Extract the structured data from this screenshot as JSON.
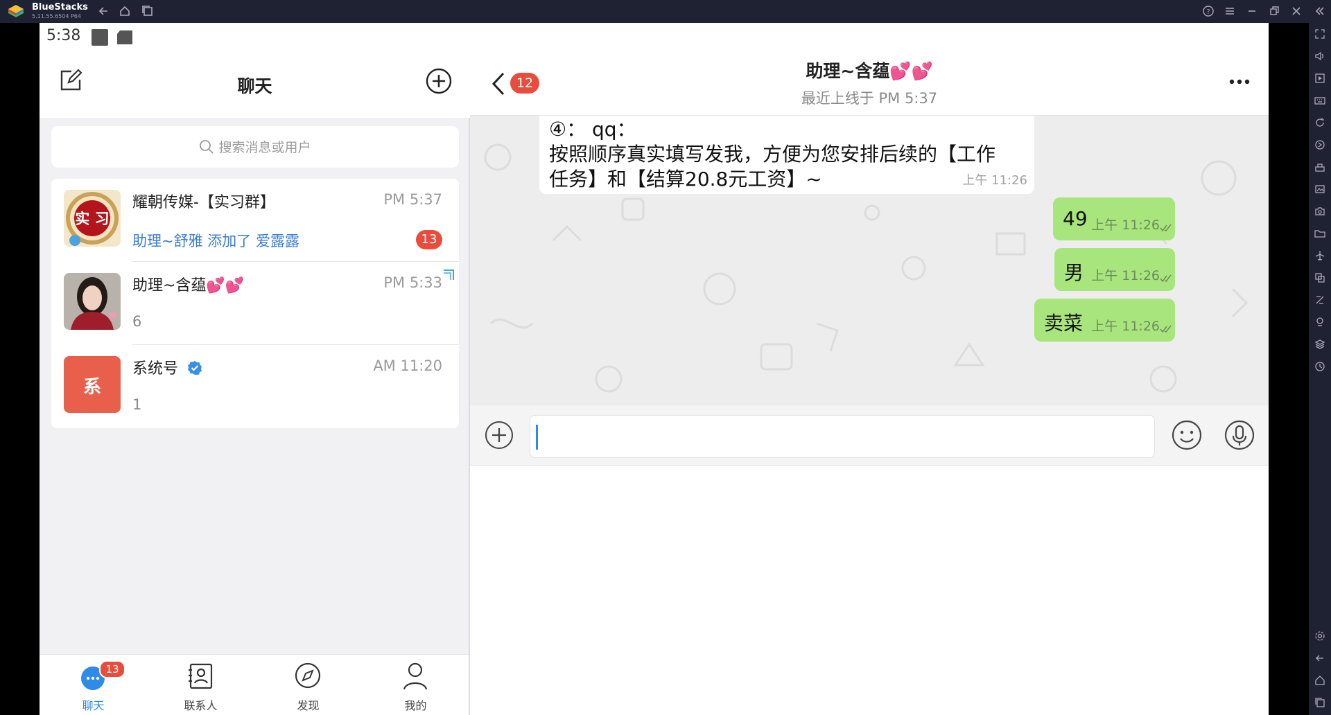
{
  "emulator": {
    "name": "BlueStacks",
    "version": "5.11.55.6504 P64"
  },
  "status_bar": {
    "time": "5:38"
  },
  "left_panel": {
    "title": "聊天",
    "search_placeholder": "搜索消息或用户",
    "chats": [
      {
        "avatar_text": "实 习",
        "name": "耀朝传媒-【实习群】",
        "time": "PM 5:37",
        "message": "助理~舒雅 添加了 爱露露",
        "badge": "13"
      },
      {
        "name": "助理~含蕴💕💕",
        "time": "PM 5:33",
        "message": "6"
      },
      {
        "avatar_text": "系",
        "name": "系统号",
        "time": "AM 11:20",
        "message": "1"
      }
    ],
    "tabs": [
      {
        "label": "聊天",
        "badge": "13"
      },
      {
        "label": "联系人"
      },
      {
        "label": "发现"
      },
      {
        "label": "我的"
      }
    ]
  },
  "right_panel": {
    "back_badge": "12",
    "title": "助理~含蕴💕💕",
    "subtitle": "最近上线于 PM 5:37",
    "messages": [
      {
        "direction": "in",
        "text": "④： qq：\n按照顺序真实填写发我，方便为您安排后续的【工作\n任务】和【结算20.8元工资】~",
        "time": "上午 11:26"
      },
      {
        "direction": "out",
        "text": "49",
        "time": "上午 11:26"
      },
      {
        "direction": "out",
        "text": "男",
        "time": "上午 11:26"
      },
      {
        "direction": "out",
        "text": "卖菜",
        "time": "上午 11:26"
      }
    ],
    "input_value": ""
  },
  "colors": {
    "accent": "#2f8be6",
    "badge": "#e74c3c",
    "out_bubble": "#a8e57c",
    "system_avatar": "#e8604c"
  }
}
